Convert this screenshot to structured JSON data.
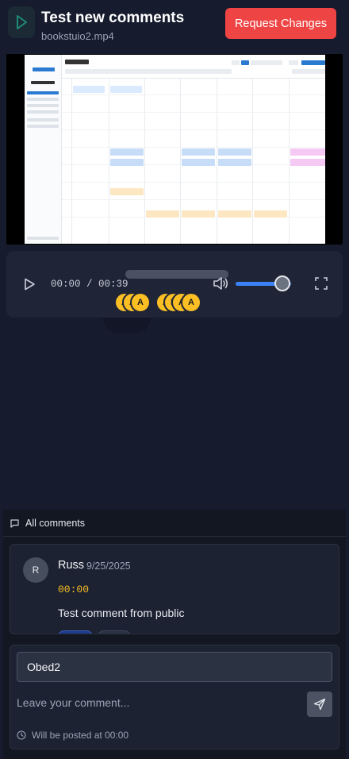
{
  "header": {
    "title": "Test new comments",
    "subtitle": "bookstuio2.mp4",
    "request_changes_label": "Request Changes"
  },
  "player": {
    "current_time": "00:00",
    "duration": "00:39",
    "time_display": "00:00 / 00:39",
    "progress_fraction": 0.0,
    "volume_fraction": 1.0,
    "comment_markers": [
      "A",
      "A",
      "A",
      "A",
      "R",
      "A",
      "A"
    ]
  },
  "comments": {
    "header_label": "All comments",
    "items": [
      {
        "avatar_initial": "R",
        "author": "Russ",
        "date": "9/25/2025",
        "timestamp": "00:00",
        "text": "Test comment from public"
      }
    ]
  },
  "form": {
    "name_value": "Obed2",
    "comment_placeholder": "Leave your comment...",
    "post_hint": "Will be posted at 00:00"
  },
  "colors": {
    "background": "#161b2d",
    "accent_danger": "#ef4444",
    "marker": "#fbbf24",
    "volume": "#3b82f6"
  },
  "icons": {
    "app_logo": "play-logo-icon",
    "play": "play-icon",
    "volume": "volume-icon",
    "fullscreen": "fullscreen-icon",
    "comments": "message-icon",
    "send": "send-icon",
    "clock": "clock-icon"
  }
}
